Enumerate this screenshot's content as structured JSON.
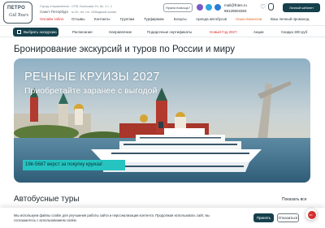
{
  "header": {
    "logo_line1": "ПЕТРО",
    "logo_line2": "Gid Tours",
    "city_label": "Город отправления:",
    "city_name": "Санкт-Петербург",
    "address_line1": "СПб, Большая Ул. 6к. 1 г. 1",
    "address_line2": "м.Ул. пл. пл. Обводный канал",
    "help_button": "Нужна помощь?",
    "email": "mail@fntes.ru",
    "phone": "88129503383",
    "cabinet_button": "Личный кабинет",
    "colors": {
      "brand": "#15404c",
      "accent_red": "#d62c2c",
      "accent_orange": "#e5702a",
      "teal": "#25c4c1"
    }
  },
  "menu_top": [
    {
      "label": "Онлайн табло"
    },
    {
      "label": "Отзывы"
    },
    {
      "label": "Контакты"
    },
    {
      "label": "Группам"
    },
    {
      "label": "Турфирмам"
    },
    {
      "label": "Бонусы"
    },
    {
      "label": "Аренда автобусов"
    },
    {
      "label": "Наши вакансии"
    },
    {
      "label": "Ваш личный промокод"
    }
  ],
  "menu_main": {
    "excursion_button": "Выбрать экскурсию",
    "items": [
      {
        "label": "Расписание"
      },
      {
        "label": "Направление"
      },
      {
        "label": "Подарочные сертификаты"
      },
      {
        "label": "Новый Год 2027"
      },
      {
        "label": "Акции"
      },
      {
        "label": "Скидка 300 руб"
      }
    ]
  },
  "page": {
    "title": "Бронирование экскурсий и туров по России и миру",
    "section_title": "Автобусные туры",
    "show_all": "Показать все"
  },
  "banner": {
    "title": "РЕЧНЫЕ КРУИЗЫ 2027",
    "subtitle": "Приобретайте заранее с выгодой",
    "promo": "19ê-5687 верст за покупку круиза!"
  },
  "cookie": {
    "line1": "Мы используем файлы cookie для улучшения работы сайта и персонализации контента. Продолжая использовать сайт, вы",
    "line2": "соглашаетесь с использованием cookie.",
    "accept": "Принять",
    "decline": "Отказаться"
  }
}
